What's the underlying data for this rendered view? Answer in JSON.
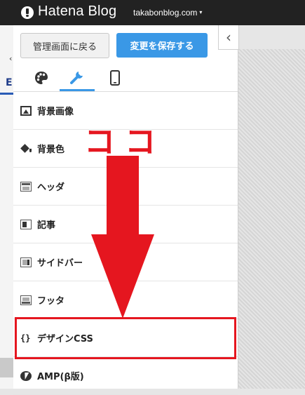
{
  "topbar": {
    "logo_text": "Hatena Blog",
    "account": "takabonblog.com",
    "account_caret": "▾"
  },
  "left_strip": {
    "letter": "E",
    "arrow": "‹"
  },
  "collapse_button": "‹",
  "panel": {
    "back_button": "管理画面に戻る",
    "save_button": "変更を保存する",
    "tabs": [
      {
        "icon": "palette-icon",
        "active": false
      },
      {
        "icon": "wrench-icon",
        "active": true
      },
      {
        "icon": "smartphone-icon",
        "active": false
      }
    ],
    "menu": [
      {
        "label": "背景画像",
        "icon": "image-icon"
      },
      {
        "label": "背景色",
        "icon": "paint-bucket-icon"
      },
      {
        "label": "ヘッダ",
        "icon": "header-layout-icon"
      },
      {
        "label": "記事",
        "icon": "article-layout-icon"
      },
      {
        "label": "サイドバー",
        "icon": "sidebar-layout-icon"
      },
      {
        "label": "フッタ",
        "icon": "footer-layout-icon"
      },
      {
        "label": "デザインCSS",
        "icon": "braces-icon"
      },
      {
        "label": "AMP(β版)",
        "icon": "bolt-icon"
      }
    ]
  },
  "annotation": {
    "text": "ココ",
    "color": "#e5161f"
  },
  "colors": {
    "accent": "#3a98e6",
    "topbar": "#222222",
    "annotation": "#e5161f"
  }
}
